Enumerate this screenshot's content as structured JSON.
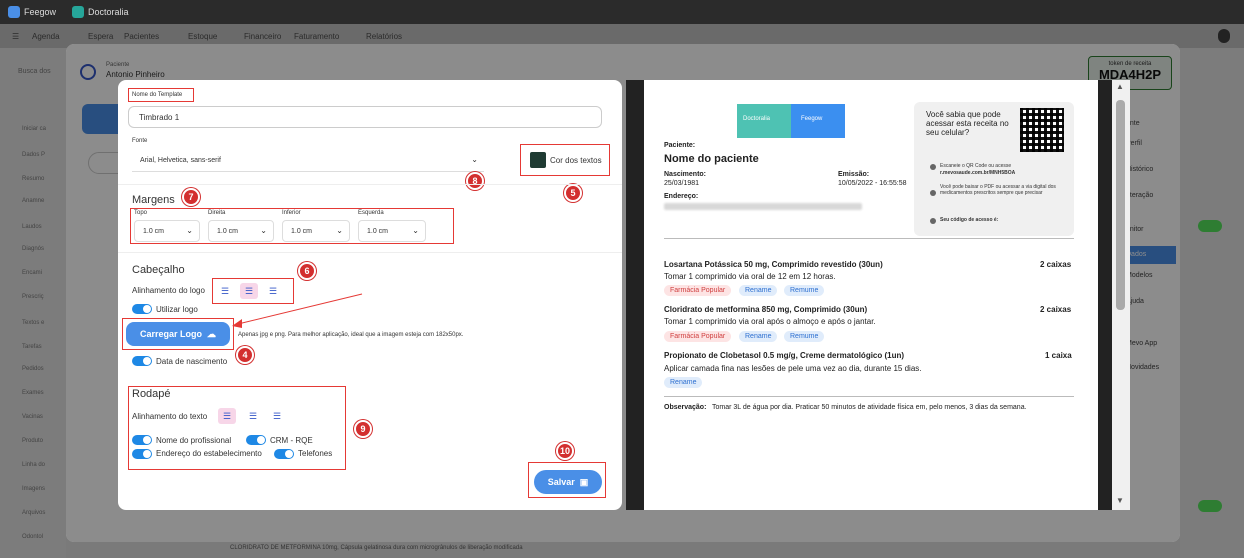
{
  "topbar": {
    "tab1": "Feegow",
    "tab2": "Doctoralia"
  },
  "nav": {
    "items": [
      "Agenda",
      "Espera",
      "Pacientes",
      "Estoque",
      "Financeiro",
      "Faturamento",
      "Relatórios"
    ]
  },
  "search": {
    "placeholder": "Busca dos"
  },
  "left_menu": [
    "Iniciar ca",
    "Dados P",
    "Resumo",
    "Anamne",
    "Laudos",
    "Diagnós",
    "Encami",
    "Prescriç",
    "Textos e",
    "Tarefas",
    "Pedidos",
    "Exames",
    "Vacinas",
    "Produto",
    "Linha do",
    "Imagens",
    "Arquivos",
    "Odontol"
  ],
  "patient": {
    "label": "Paciente",
    "name": "Antonio Pinheiro"
  },
  "token": {
    "label": "token de receita",
    "value": "MDA4H2P"
  },
  "right_menu": [
    "ente",
    "Perfil",
    "Histórico",
    "nteração",
    "onitor",
    "Dados",
    "Modelos",
    "Ajuda",
    "Mevo App",
    "Novidades"
  ],
  "form": {
    "template_name_label": "Nome do Template",
    "template_name_value": "Timbrado 1",
    "font_label": "Fonte",
    "font_value": "Arial, Helvetica, sans-serif",
    "text_color_label": "Cor dos textos",
    "margins_title": "Margens",
    "margins": [
      {
        "label": "Topo",
        "value": "1.0 cm"
      },
      {
        "label": "Direita",
        "value": "1.0 cm"
      },
      {
        "label": "Inferior",
        "value": "1.0 cm"
      },
      {
        "label": "Esquerda",
        "value": "1.0 cm"
      }
    ],
    "header_title": "Cabeçalho",
    "logo_align_label": "Alinhamento do logo",
    "use_logo_label": "Utilizar logo",
    "upload_logo_label": "Carregar Logo",
    "upload_hint": "Apenas jpg e png. Para melhor aplicação, ideal que a imagem esteja com 182x50px.",
    "birth_date_label": "Data de nascimento",
    "footer_title": "Rodapé",
    "text_align_label": "Alinhamento do texto",
    "footer_toggles": {
      "prof": "Nome do profissional",
      "crm": "CRM - RQE",
      "address": "Endereço do estabelecimento",
      "phones": "Telefones"
    },
    "save_label": "Salvar",
    "badges": {
      "b4": "4",
      "b5": "5",
      "b6": "6",
      "b7": "7",
      "b8": "8",
      "b9": "9",
      "b10": "10"
    }
  },
  "doc": {
    "brand1": "Doctoralia",
    "brand2": "Feegow",
    "patient_label": "Paciente:",
    "patient_name": "Nome do paciente",
    "birth_label": "Nascimento:",
    "birth_value": "25/03/1981",
    "emission_label": "Emissão:",
    "emission_value": "10/05/2022 - 16:55:58",
    "address_label": "Endereço:",
    "qr_title": "Você sabia que pode acessar esta receita no seu celular?",
    "qr_step1": "Escaneie o QR Code ou acesse",
    "qr_step1_url": "r.mevosaude.com.br/MNH5BOA",
    "qr_step2": "Você pode baixar o PDF ou acessar a via digital dos medicamentos prescritos sempre que precisar",
    "qr_step3": "Seu código de acesso é:",
    "meds": [
      {
        "name": "Losartana Potássica 50 mg, Comprimido revestido (30un)",
        "qty": "2 caixas",
        "instr": "Tomar 1 comprimido via oral de 12 em 12 horas."
      },
      {
        "name": "Cloridrato de metformina 850 mg, Comprimido (30un)",
        "qty": "2 caixas",
        "instr": "Tomar 1 comprimido via oral após o almoço e após o jantar."
      },
      {
        "name": "Propionato de Clobetasol 0.5 mg/g, Creme dermatológico (1un)",
        "qty": "1 caixa",
        "instr": "Aplicar camada fina nas lesões de pele uma vez ao dia, durante 15 dias."
      }
    ],
    "tags": {
      "fp": "Farmácia Popular",
      "rn": "Rename",
      "rm": "Remume"
    },
    "obs_label": "Observação:",
    "obs_text": "Tomar 3L de água por dia. Praticar 50 minutos de atividade física em, pelo menos, 3 dias da semana."
  },
  "bottom_text": "CLORIDRATO DE METFORMINA 10mg, Cápsula gelatinosa dura com microgrânulos de liberação modificada"
}
